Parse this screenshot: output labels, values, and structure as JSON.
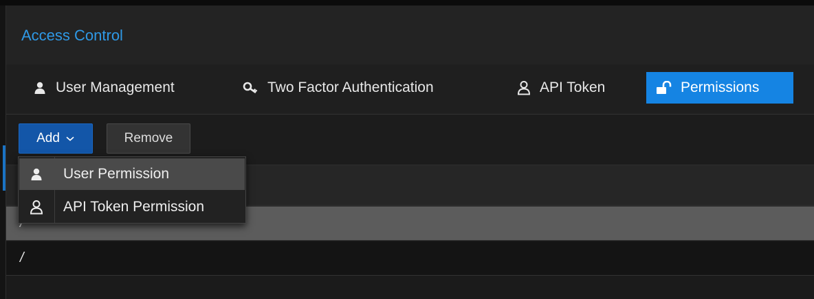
{
  "window": {
    "title": "Access Control"
  },
  "tabs": [
    {
      "label": "User Management",
      "icon": "user-icon",
      "active": false
    },
    {
      "label": "Two Factor Authentication",
      "icon": "key-icon",
      "active": false
    },
    {
      "label": "API Token",
      "icon": "user-outline-icon",
      "active": false
    },
    {
      "label": "Permissions",
      "icon": "unlock-icon",
      "active": true
    }
  ],
  "toolbar": {
    "add_label": "Add",
    "remove_label": "Remove"
  },
  "add_menu": {
    "items": [
      {
        "label": "User Permission",
        "icon": "user-icon",
        "highlighted": true
      },
      {
        "label": "API Token Permission",
        "icon": "user-outline-icon",
        "highlighted": false
      }
    ]
  },
  "grid": {
    "rows": [
      {
        "path": "/",
        "selected": true
      },
      {
        "path": "/",
        "selected": false
      }
    ]
  },
  "colors": {
    "accent": "#1584e3",
    "title": "#2f99e6",
    "add_button": "#1356a8"
  }
}
